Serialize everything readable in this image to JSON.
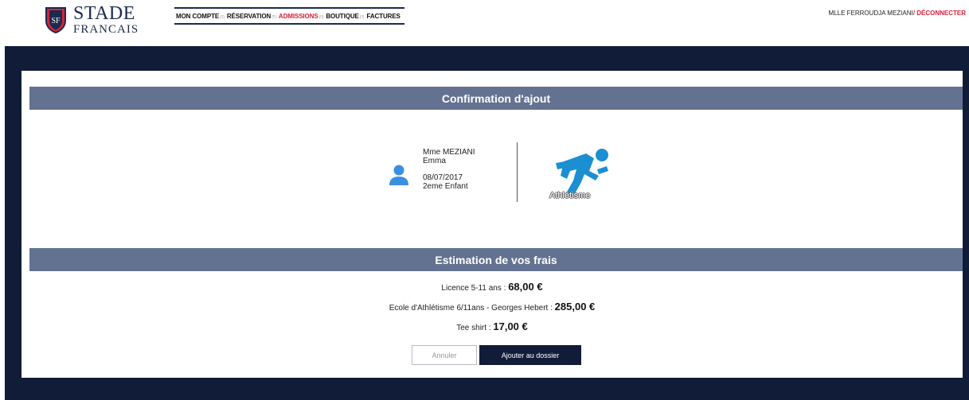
{
  "brand": {
    "line1": "STADE",
    "line2": "FRANCAIS",
    "monogram": "SF"
  },
  "nav": [
    {
      "label": "MON COMPTE",
      "active": false
    },
    {
      "label": "RÉSERVATION",
      "active": false
    },
    {
      "label": "ADMISSIONS",
      "active": true
    },
    {
      "label": "BOUTIQUE",
      "active": false
    },
    {
      "label": "FACTURES",
      "active": false
    }
  ],
  "nav_separator": "(!!)",
  "user": {
    "name": "MLLE FERROUDJA MEZIANI",
    "slash": "/",
    "logout": "DÉCONNECTER"
  },
  "confirmation": {
    "title": "Confirmation d'ajout",
    "person": {
      "name": "Mme MEZIANI",
      "first_name": "Emma",
      "birthdate": "08/07/2017",
      "rank": "2eme Enfant",
      "icon": "user-icon"
    },
    "activity": {
      "label": "Athlétisme",
      "icon": "runner-icon"
    }
  },
  "estimation": {
    "title": "Estimation de vos frais",
    "lines": [
      {
        "label": "Licence 5-11 ans : ",
        "amount": "68,00 €"
      },
      {
        "label": "Ecole d'Athlétisme 6/11ans - Georges Hebert : ",
        "amount": "285,00 €"
      },
      {
        "label": "Tee shirt : ",
        "amount": "17,00 €"
      }
    ]
  },
  "actions": {
    "cancel": "Annuler",
    "add": "Ajouter au dossier"
  },
  "colors": {
    "navy": "#111d38",
    "bar": "#647291",
    "accent": "#d9213b",
    "icon_blue": "#1b8fd1"
  }
}
